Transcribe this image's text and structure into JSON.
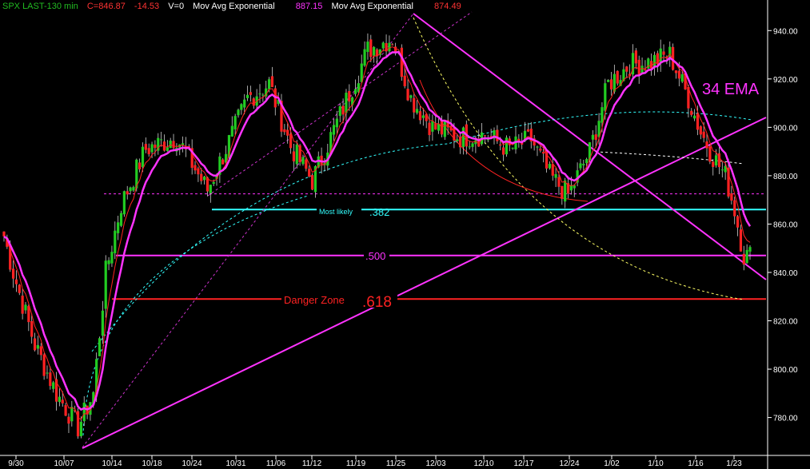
{
  "header": {
    "symbol": "SPX LAST-130 min",
    "close": "C=846.87",
    "change": "-14.53",
    "volume": "V=0",
    "ma1_name": "Mov Avg Exponential",
    "ma1_value": "887.15",
    "ma2_name": "Mov Avg Exponential",
    "ma2_value": "874.49",
    "colors": {
      "symbol": "#22bb22",
      "price": "#ff3333",
      "ma1": "#ff33ff",
      "ma2": "#ff3333"
    }
  },
  "annotations": {
    "ema_label": "34 EMA",
    "fib382": ".382",
    "most_likely": "Most likely",
    "fib500": ".500",
    "danger_zone": "Danger Zone",
    "fib618": ".618"
  },
  "chart_data": {
    "type": "candlestick",
    "x_tick_labels": [
      "9/30",
      "10/07",
      "10/14",
      "10/18",
      "10/24",
      "10/31",
      "11/06",
      "11/12",
      "11/19",
      "11/25",
      "12/03",
      "12/10",
      "12/17",
      "12/24",
      "1/02",
      "1/10",
      "1/16",
      "1/23"
    ],
    "ylim": [
      765,
      950
    ],
    "y_ticks": [
      780,
      800,
      820,
      840,
      860,
      880,
      900,
      920,
      940
    ],
    "y_tick_labels": [
      "780.00",
      "800.00",
      "820.00",
      "840.00",
      "860.00",
      "880.00",
      "900.00",
      "920.00",
      "940.00"
    ],
    "colors": {
      "up": "#22cc22",
      "down": "#ff2222",
      "ema34": "#ff33ff",
      "ema_fast": "#ff2222",
      "fib382": "#33ffff",
      "fib500": "#ff33ff",
      "fib618": "#ff2222"
    },
    "levels": {
      "fib382": 866,
      "fib500": 847,
      "fib618": 829,
      "dotted": 872.5
    },
    "key_points": [
      {
        "t": 0,
        "v": 855
      },
      {
        "t": 3,
        "v": 840
      },
      {
        "t": 10,
        "v": 810
      },
      {
        "t": 17,
        "v": 790
      },
      {
        "t": 24,
        "v": 776
      },
      {
        "t": 29,
        "v": 790
      },
      {
        "t": 33,
        "v": 840
      },
      {
        "t": 38,
        "v": 868
      },
      {
        "t": 46,
        "v": 891
      },
      {
        "t": 56,
        "v": 896
      },
      {
        "t": 66,
        "v": 874
      },
      {
        "t": 74,
        "v": 897
      },
      {
        "t": 79,
        "v": 912
      },
      {
        "t": 86,
        "v": 918
      },
      {
        "t": 93,
        "v": 892
      },
      {
        "t": 100,
        "v": 878
      },
      {
        "t": 108,
        "v": 902
      },
      {
        "t": 118,
        "v": 932
      },
      {
        "t": 126,
        "v": 937
      },
      {
        "t": 132,
        "v": 912
      },
      {
        "t": 139,
        "v": 900
      },
      {
        "t": 148,
        "v": 896
      },
      {
        "t": 156,
        "v": 897
      },
      {
        "t": 164,
        "v": 891
      },
      {
        "t": 171,
        "v": 895
      },
      {
        "t": 177,
        "v": 880
      },
      {
        "t": 183,
        "v": 872
      },
      {
        "t": 190,
        "v": 890
      },
      {
        "t": 196,
        "v": 918
      },
      {
        "t": 203,
        "v": 926
      },
      {
        "t": 210,
        "v": 927
      },
      {
        "t": 216,
        "v": 930
      },
      {
        "t": 222,
        "v": 912
      },
      {
        "t": 226,
        "v": 898
      },
      {
        "t": 230,
        "v": 888
      },
      {
        "t": 234,
        "v": 880
      },
      {
        "t": 237,
        "v": 866
      },
      {
        "t": 240,
        "v": 847
      }
    ]
  }
}
